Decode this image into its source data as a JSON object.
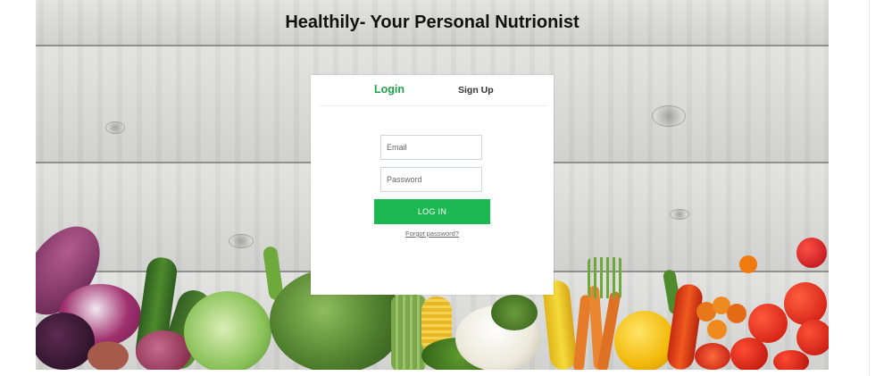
{
  "header": {
    "title": "Healthily- Your Personal Nutrionist"
  },
  "tabs": {
    "login": "Login",
    "signup": "Sign Up"
  },
  "form": {
    "email_placeholder": "Email",
    "password_placeholder": "Password",
    "login_button": "LOG IN",
    "forgot_link": "Forgot password?"
  },
  "colors": {
    "accent": "#1cb852",
    "tab_active": "#21a34c",
    "title": "#111111"
  }
}
